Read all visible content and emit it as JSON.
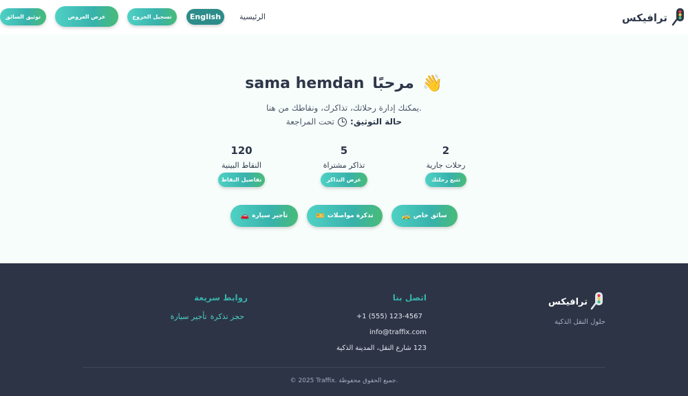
{
  "header": {
    "brand": "ترافيكس",
    "logo_icon": "traffic-light-icon",
    "home": "الرئيسية",
    "english": "English",
    "logout": "تسجيل الخروج",
    "offers": "عرض العروض",
    "driver_verify": "توثيق السائق"
  },
  "main": {
    "welcome_name": "sama hemdan",
    "welcome_greeting": "مرحبًا",
    "wave_emoji": "👋",
    "subtitle": "يمكنك إدارة رحلاتك، تذاكرك، ونقاطك من هنا.",
    "verification_label": "حالة التوثيق:",
    "verification_status": "تحت المراجعة",
    "stats": [
      {
        "value": "2",
        "label": "رحلات جارية",
        "button": "تتبع رحلتك"
      },
      {
        "value": "5",
        "label": "تذاكر مشتراة",
        "button": "عرض التذاكر"
      },
      {
        "value": "120",
        "label": "النقاط البينية",
        "button": "تفاصيل النقاط"
      }
    ],
    "actions": [
      {
        "label": "سائق خاص",
        "emoji": "🚕"
      },
      {
        "label": "تذكرة مواصلات",
        "emoji": "🎫"
      },
      {
        "label": "تأجير سيارة",
        "emoji": "🚗"
      }
    ]
  },
  "footer": {
    "brand": "ترافيكس",
    "tagline": "حلول النقل الذكية",
    "contact_heading": "اتصل بنا",
    "phone": "+1 (555) 123-4567",
    "email": "info@traffix.com",
    "address": "123 شارع النقل، المدينة الذكية",
    "links_heading": "روابط سريعة",
    "links": [
      "حجز تذكرة",
      "تأجير سيارة"
    ],
    "copyright": "© 2025 Traffix. جميع الحقوق محفوظة."
  },
  "colors": {
    "accent": "#38b2ac",
    "accent_green": "#48bb78",
    "footer_bg": "#2d3446",
    "main_bg": "#f7fdfb"
  }
}
